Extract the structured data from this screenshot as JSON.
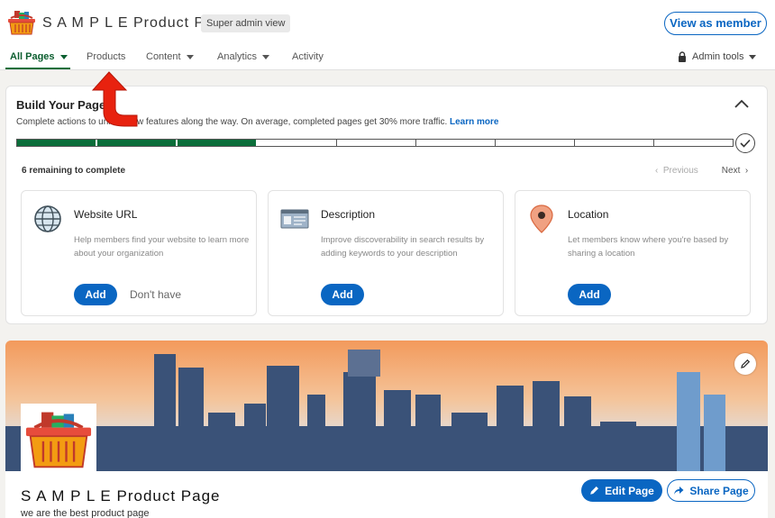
{
  "header": {
    "page_name": "S A M P L E Product Page",
    "badge": "Super admin view",
    "view_as_member": "View as member"
  },
  "nav": {
    "items": [
      "All Pages",
      "Products",
      "Content",
      "Analytics",
      "Activity"
    ],
    "admin_tools": "Admin tools"
  },
  "build": {
    "title": "Build Your Page",
    "subtitle": "Complete actions to unlock new features along the way. On average, completed pages get 30% more traffic.",
    "learn_more": "Learn more",
    "progress": {
      "completed": 3,
      "total": 9
    },
    "remaining": "6 remaining to complete",
    "previous": "Previous",
    "next": "Next",
    "tasks": [
      {
        "title": "Website URL",
        "desc": "Help members find your website to learn more about your organization",
        "add": "Add",
        "secondary": "Don't have",
        "icon": "globe-icon"
      },
      {
        "title": "Description",
        "desc": "Improve discoverability in search results by adding keywords to your description",
        "add": "Add",
        "icon": "description-icon"
      },
      {
        "title": "Location",
        "desc": "Let members know where you're based by sharing a location",
        "add": "Add",
        "icon": "location-pin-icon"
      }
    ]
  },
  "profile": {
    "name": "S A M P L E Product Page",
    "tagline": "we are the best product page",
    "edit_page": "Edit Page",
    "share_page": "Share Page"
  },
  "colors": {
    "brand_blue": "#0a66c2",
    "progress_green": "#0b6e3a",
    "arrow_red": "#e8220f"
  }
}
